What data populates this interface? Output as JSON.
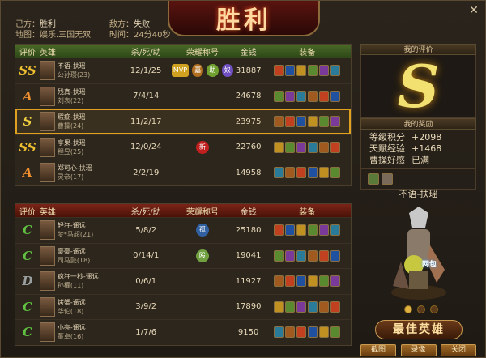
{
  "title": "胜利",
  "info": {
    "side": "己方：",
    "result": "胜利",
    "enemy": "敌方：",
    "enemy_result": "失败",
    "map": "地图：娱乐.三国无双",
    "time": "时间：24分40秒"
  },
  "columns_win": [
    "评价",
    "英雄",
    "杀/死/助",
    "荣耀称号",
    "金钱",
    "装备"
  ],
  "columns_lose": [
    "评价",
    "英雄",
    "杀/死/助",
    "荣耀称号",
    "金钱",
    "装备"
  ],
  "winners": [
    {
      "grade": "SS",
      "name": "不语-扶瑶",
      "hero": "公孙瓒(23)",
      "kda": "12/1/25",
      "gold": "31887",
      "badges": [
        "MVP",
        "嘉",
        "助",
        "奴"
      ]
    },
    {
      "grade": "A",
      "name": "残真-扶瑶",
      "hero": "刘表(22)",
      "kda": "7/4/14",
      "gold": "24678",
      "badges": []
    },
    {
      "grade": "S",
      "name": "瑕疵-扶瑶",
      "hero": "曹操(24)",
      "kda": "11/2/17",
      "gold": "23975",
      "badges": []
    },
    {
      "grade": "SS",
      "name": "亭果-扶瑶",
      "hero": "程昱(25)",
      "kda": "12/0/24",
      "gold": "22760",
      "badges": [
        "新"
      ]
    },
    {
      "grade": "A",
      "name": "郑可心-扶瑶",
      "hero": "灵帝(17)",
      "kda": "2/2/19",
      "gold": "14958",
      "badges": []
    }
  ],
  "losers": [
    {
      "grade": "C",
      "name": "轻狂-遥远",
      "hero": "梦*马超(21)",
      "kda": "5/8/2",
      "gold": "25180",
      "badges": [
        "孤"
      ]
    },
    {
      "grade": "C",
      "name": "豪豪-遥远",
      "hero": "司马懿(18)",
      "kda": "0/14/1",
      "gold": "19041",
      "badges": [
        "殴"
      ]
    },
    {
      "grade": "D",
      "name": "疯狂一秒-遥远",
      "hero": "孙權(11)",
      "kda": "0/6/1",
      "gold": "11927",
      "badges": []
    },
    {
      "grade": "C",
      "name": "烤蟹-遥远",
      "hero": "华佗(18)",
      "kda": "3/9/2",
      "gold": "17890",
      "badges": []
    },
    {
      "grade": "C",
      "name": "小亮-遥远",
      "hero": "董卓(16)",
      "kda": "1/7/6",
      "gold": "9150",
      "badges": []
    }
  ],
  "my_eval": {
    "label": "我的评价",
    "grade": "S"
  },
  "my_reward": {
    "label": "我的奖励",
    "lines": [
      [
        "等级积分",
        "+2098"
      ],
      [
        "天赋经验",
        "+1468"
      ],
      [
        "曹操好感",
        "已满"
      ]
    ]
  },
  "best_hero": {
    "player": "不语-扶瑶",
    "pet_label": "网包",
    "title": "最佳英雄"
  },
  "buttons": {
    "screenshot": "截图",
    "record": "录像",
    "close": "关闭"
  },
  "colors": {
    "accent": "#e0a020",
    "win": "#4a6a28",
    "lose": "#7a2418"
  }
}
